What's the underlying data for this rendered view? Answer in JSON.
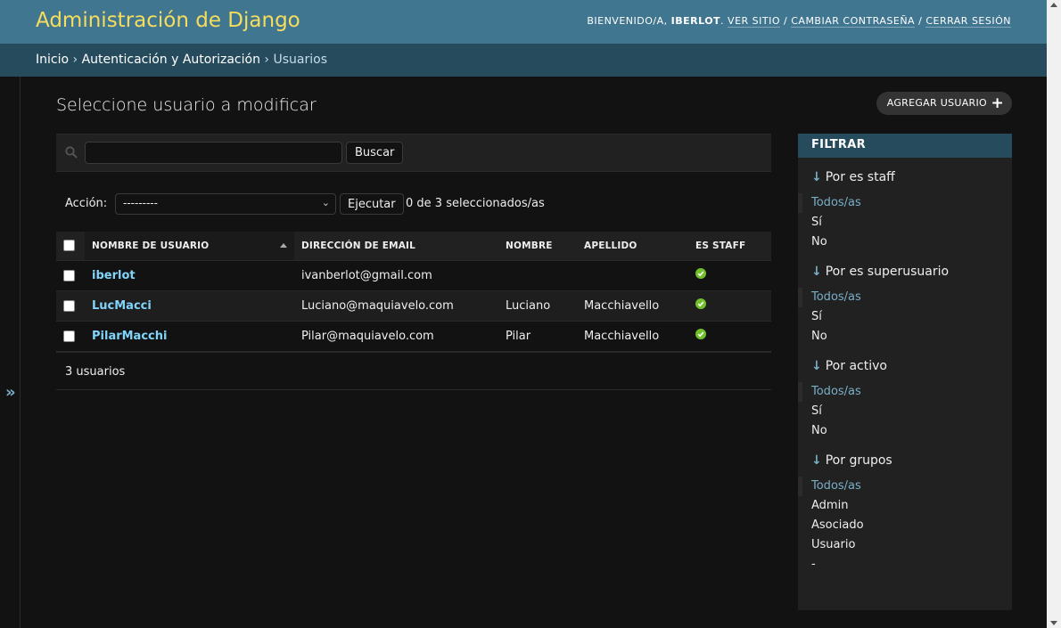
{
  "header": {
    "site_title": "Administración de Django",
    "welcome": "BIENVENIDO/A,",
    "username": "IBERLOT",
    "view_site": "VER SITIO",
    "change_password": "CAMBIAR CONTRASEÑA",
    "logout": "CERRAR SESIÓN",
    "sep1": ".",
    "sep2": "/",
    "sep3": "/"
  },
  "breadcrumbs": {
    "home": "Inicio",
    "app": "Autenticación y Autorización",
    "current": "Usuarios",
    "separator": "›"
  },
  "nav_toggle": "»",
  "page": {
    "title": "Seleccione usuario a modificar",
    "add_button": "AGREGAR USUARIO",
    "add_icon": "+"
  },
  "search": {
    "value": "",
    "placeholder": "",
    "button": "Buscar",
    "icon": "search-icon"
  },
  "actions": {
    "label": "Acción:",
    "selected_option": "---------",
    "run_button": "Ejecutar",
    "selected_count": "0 de 3 seleccionados/as"
  },
  "table": {
    "columns": [
      "NOMBRE DE USUARIO",
      "DIRECCIÓN DE EMAIL",
      "NOMBRE",
      "APELLIDO",
      "ES STAFF"
    ],
    "rows": [
      {
        "username": "iberlot",
        "email": "ivanberlot@gmail.com",
        "first_name": "",
        "last_name": "",
        "is_staff": true
      },
      {
        "username": "LucMacci",
        "email": "Luciano@maquiavelo.com",
        "first_name": "Luciano",
        "last_name": "Macchiavello",
        "is_staff": true
      },
      {
        "username": "PilarMacchi",
        "email": "Pilar@maquiavelo.com",
        "first_name": "Pilar",
        "last_name": "Macchiavello",
        "is_staff": true
      }
    ],
    "footer": "3 usuarios"
  },
  "filter": {
    "title": "FILTRAR",
    "arrow": "↓",
    "groups": [
      {
        "heading": "Por es staff",
        "options": [
          "Todos/as",
          "Sí",
          "No"
        ]
      },
      {
        "heading": "Por es superusuario",
        "options": [
          "Todos/as",
          "Sí",
          "No"
        ]
      },
      {
        "heading": "Por activo",
        "options": [
          "Todos/as",
          "Sí",
          "No"
        ]
      },
      {
        "heading": "Por grupos",
        "options": [
          "Todos/as",
          "Admin",
          "Asociado",
          "Usuario",
          "-"
        ]
      }
    ]
  },
  "colors": {
    "header_bg": "#417690",
    "title_yellow": "#f5dd5d",
    "breadcrumb_bg": "#264b5d",
    "link_blue": "#81d4fa",
    "accent_blue": "#79aec8",
    "staff_yes_green": "#70bf2b"
  }
}
